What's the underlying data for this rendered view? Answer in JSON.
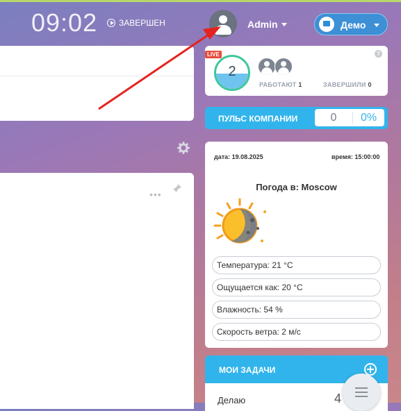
{
  "header": {
    "clock": "09:02",
    "status": "ЗАВЕРШЕН",
    "user": "Admin",
    "demo_label": "Демо"
  },
  "stats": {
    "live_badge": "LIVE",
    "count": "2",
    "working_label": "РАБОТАЮТ",
    "working_value": "1",
    "finished_label": "ЗАВЕРШИЛИ",
    "finished_value": "0",
    "help": "?"
  },
  "pulse": {
    "title": "ПУЛЬС КОМПАНИИ",
    "value": "0",
    "percent": "0%"
  },
  "weather": {
    "date": "дата: 19.08.2025",
    "time": "время: 15:00:00",
    "title": "Погода в: Moscow",
    "temperature": "Температура: 21 °C",
    "feels": "Ощущается как: 20 °C",
    "humidity": "Влажность: 54 %",
    "wind": "Скорость ветра: 2 м/с"
  },
  "tasks": {
    "title": "МОИ ЗАДАЧИ",
    "first_item": "Делаю"
  }
}
